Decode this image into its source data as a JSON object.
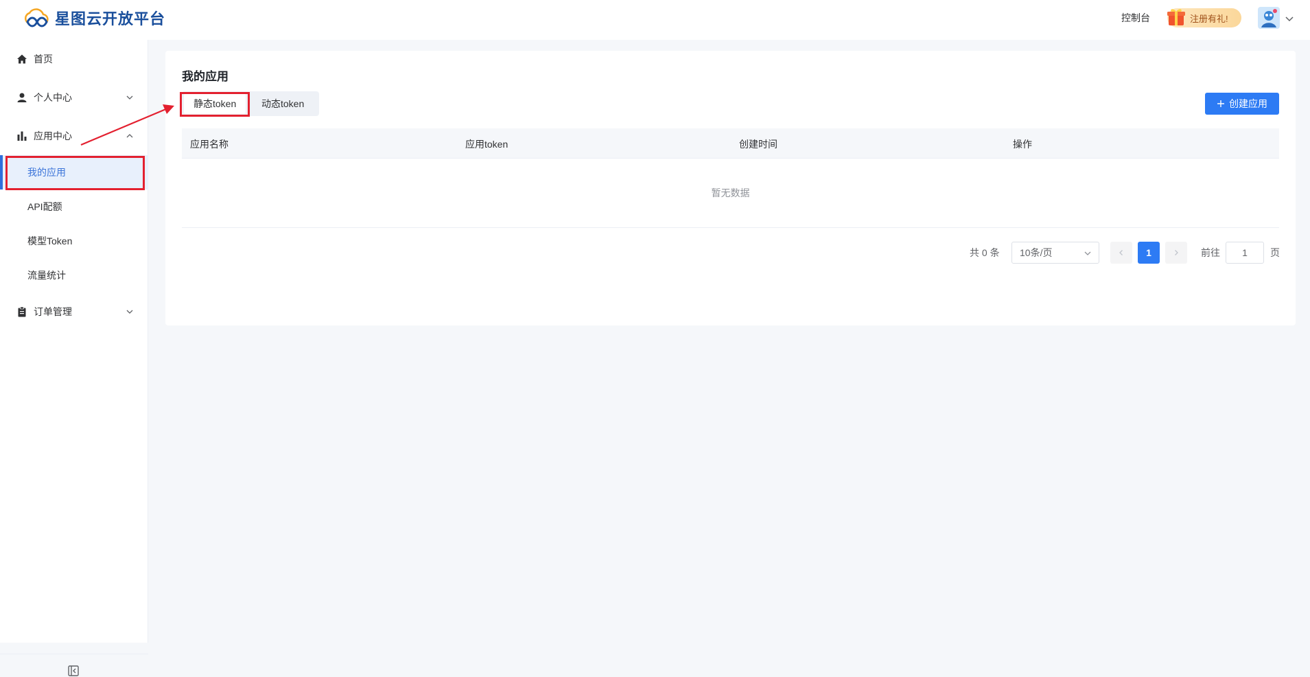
{
  "header": {
    "logo_text": "星图云开放平台",
    "console_label": "控制台",
    "gift_label": "注册有礼!"
  },
  "sidebar": {
    "items": [
      {
        "label": "首页",
        "icon": "home-icon"
      },
      {
        "label": "个人中心",
        "icon": "user-icon"
      },
      {
        "label": "应用中心",
        "icon": "bar-chart-icon"
      },
      {
        "label": "订单管理",
        "icon": "clipboard-icon"
      }
    ],
    "sub_items": [
      {
        "label": "我的应用",
        "active": true
      },
      {
        "label": "API配额"
      },
      {
        "label": "模型Token"
      },
      {
        "label": "流量统计"
      }
    ]
  },
  "main": {
    "title": "我的应用",
    "tabs": [
      {
        "label": "静态token",
        "active": true
      },
      {
        "label": "动态token"
      }
    ],
    "create_button": "创建应用",
    "table": {
      "columns": [
        "应用名称",
        "应用token",
        "创建时间",
        "操作"
      ],
      "rows": [],
      "empty_text": "暂无数据"
    },
    "pagination": {
      "total_label": "共 0 条",
      "page_size": "10条/页",
      "current_page": "1",
      "goto_label": "前往",
      "goto_value": "1",
      "page_suffix": "页"
    }
  },
  "colors": {
    "primary": "#2d7bf4",
    "active_bg": "#e8f0fc",
    "annotation_red": "#e3202f"
  }
}
